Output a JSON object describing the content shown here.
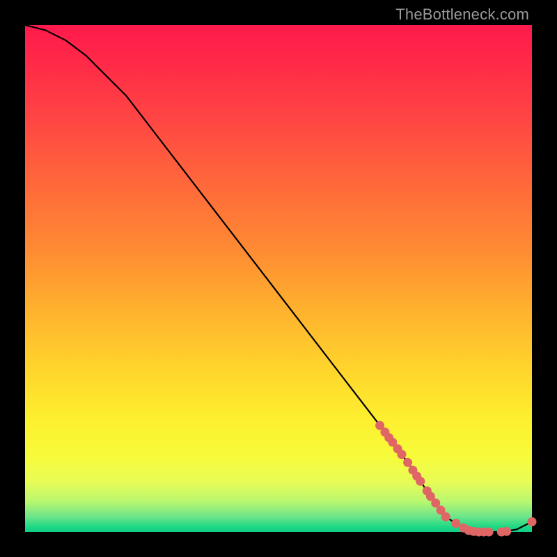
{
  "watermark": "TheBottleneck.com",
  "chart_data": {
    "type": "line",
    "title": "",
    "xlabel": "",
    "ylabel": "",
    "xlim": [
      0,
      100
    ],
    "ylim": [
      0,
      100
    ],
    "series": [
      {
        "name": "curve",
        "x": [
          0,
          4,
          8,
          12,
          16,
          20,
          30,
          40,
          50,
          60,
          70,
          76,
          80,
          83,
          86,
          90,
          94,
          97,
          100
        ],
        "y": [
          100,
          99,
          97,
          94,
          90,
          86,
          73,
          60,
          47,
          34,
          21,
          13,
          7,
          3,
          1,
          0,
          0,
          0.5,
          2
        ]
      }
    ],
    "markers": [
      {
        "x": 70.0,
        "y": 21.0
      },
      {
        "x": 71.0,
        "y": 19.7
      },
      {
        "x": 71.8,
        "y": 18.6
      },
      {
        "x": 72.5,
        "y": 17.7
      },
      {
        "x": 73.5,
        "y": 16.4
      },
      {
        "x": 74.3,
        "y": 15.3
      },
      {
        "x": 74.3,
        "y": 15.3
      },
      {
        "x": 75.5,
        "y": 13.7
      },
      {
        "x": 76.5,
        "y": 12.2
      },
      {
        "x": 77.3,
        "y": 11.0
      },
      {
        "x": 78.0,
        "y": 10.0
      },
      {
        "x": 78.0,
        "y": 10.0
      },
      {
        "x": 79.3,
        "y": 8.1
      },
      {
        "x": 80.0,
        "y": 7.0
      },
      {
        "x": 81.0,
        "y": 5.7
      },
      {
        "x": 82.0,
        "y": 4.3
      },
      {
        "x": 83.0,
        "y": 3.0
      },
      {
        "x": 83.0,
        "y": 3.0
      },
      {
        "x": 85.0,
        "y": 1.7
      },
      {
        "x": 86.5,
        "y": 0.8
      },
      {
        "x": 87.5,
        "y": 0.3
      },
      {
        "x": 88.5,
        "y": 0.1
      },
      {
        "x": 89.5,
        "y": 0.0
      },
      {
        "x": 90.5,
        "y": 0.0
      },
      {
        "x": 91.5,
        "y": 0.0
      },
      {
        "x": 94.0,
        "y": 0.0
      },
      {
        "x": 95.0,
        "y": 0.1
      },
      {
        "x": 100.0,
        "y": 2.0
      }
    ],
    "marker_color": "#e06666",
    "curve_color": "#000000"
  }
}
